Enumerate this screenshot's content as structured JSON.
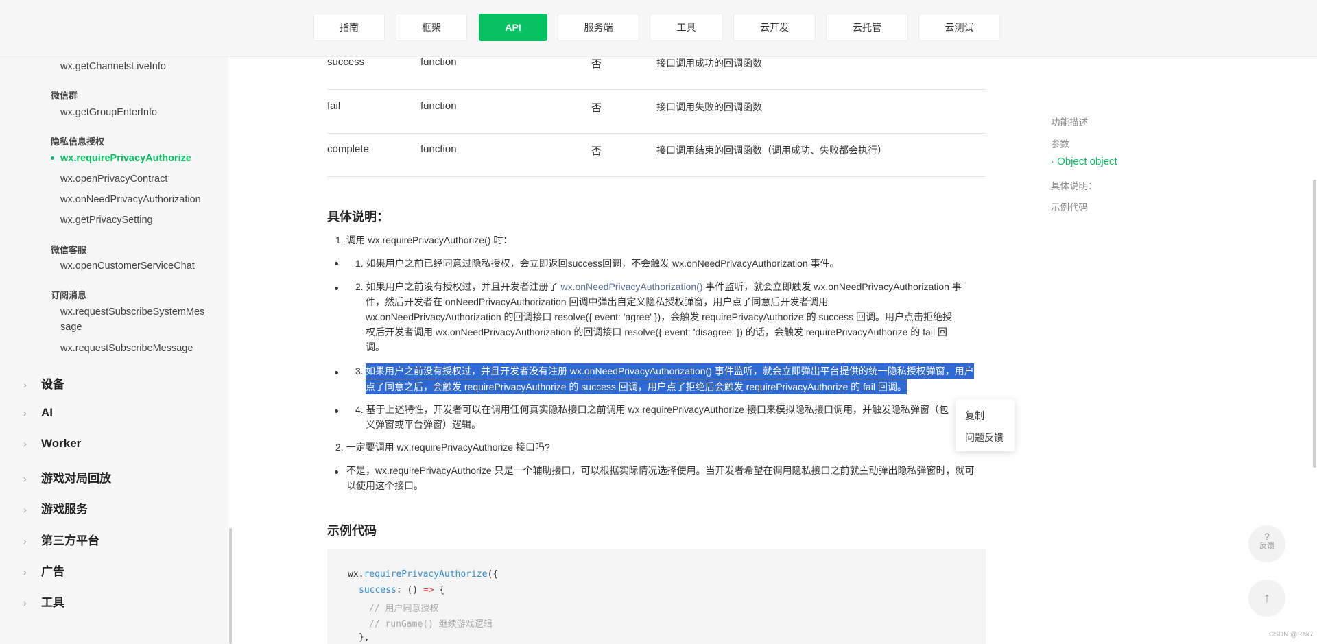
{
  "nav": {
    "tabs": [
      {
        "label": "指南",
        "active": false
      },
      {
        "label": "框架",
        "active": false
      },
      {
        "label": "API",
        "active": true
      },
      {
        "label": "服务端",
        "active": false
      },
      {
        "label": "工具",
        "active": false
      },
      {
        "label": "云开发",
        "active": false
      },
      {
        "label": "云托管",
        "active": false
      },
      {
        "label": "云测试",
        "active": false
      }
    ]
  },
  "sidebar": {
    "items": {
      "getChannelsLiveInfo": "wx.getChannelsLiveInfo",
      "group_wechat_group": "微信群",
      "getGroupEnterInfo": "wx.getGroupEnterInfo",
      "group_privacy": "隐私信息授权",
      "requirePrivacyAuthorize": "wx.requirePrivacyAuthorize",
      "openPrivacyContract": "wx.openPrivacyContract",
      "onNeedPrivacyAuthorization": "wx.onNeedPrivacyAuthorization",
      "getPrivacySetting": "wx.getPrivacySetting",
      "group_customer": "微信客服",
      "openCustomerServiceChat": "wx.openCustomerServiceChat",
      "group_subscribe": "订阅消息",
      "requestSubscribeSystemMessage_1": "wx.requestSubscribeSystemMes",
      "requestSubscribeSystemMessage_2": "sage",
      "requestSubscribeMessage": "wx.requestSubscribeMessage"
    },
    "sections": [
      "设备",
      "AI",
      "Worker",
      "游戏对局回放",
      "游戏服务",
      "第三方平台",
      "广告",
      "工具"
    ]
  },
  "params": [
    {
      "name": "success",
      "type": "function",
      "required": "否",
      "desc": "接口调用成功的回调函数"
    },
    {
      "name": "fail",
      "type": "function",
      "required": "否",
      "desc": "接口调用失败的回调函数"
    },
    {
      "name": "complete",
      "type": "function",
      "required": "否",
      "desc": "接口调用结束的回调函数（调用成功、失败都会执行）"
    }
  ],
  "details": {
    "heading": "具体说明：",
    "q1": "1. 调用 wx.requirePrivacyAuthorize() 时：",
    "b1": "1. 如果用户之前已经同意过隐私授权，会立即返回success回调，不会触发 wx.onNeedPrivacyAuthorization 事件。",
    "b2_pre": "2. 如果用户之前没有授权过，并且开发者注册了 ",
    "b2_link": "wx.onNeedPrivacyAuthorization()",
    "b2_post": " 事件监听，就会立即触发 wx.onNeedPrivacyAuthorization 事",
    "b2_l2": "件，然后开发者在 onNeedPrivacyAuthorization 回调中弹出自定义隐私授权弹窗，用户点了同意后开发者调用",
    "b2_l3": "wx.onNeedPrivacyAuthorization 的回调接口 resolve({ event: 'agree' })，会触发 requirePrivacyAuthorize 的 success 回调。用户点击拒绝授",
    "b2_l4": "权后开发者调用 wx.onNeedPrivacyAuthorization 的回调接口 resolve({ event: 'disagree' }) 的话，会触发 requirePrivacyAuthorize 的 fail 回",
    "b2_l5": "调。",
    "b3_num": "3.",
    "b3_l1": "如果用户之前没有授权过，并且开发者没有注册 wx.onNeedPrivacyAuthorization() 事件监听，就会立即弹出平台提供的统一隐私授权弹窗，用户",
    "b3_l2": "点了同意之后，会触发 requirePrivacyAuthorize 的 success 回调，用户点了拒绝后会触发 requirePrivacyAuthorize 的 fail 回调。",
    "b4_l1": "4. 基于上述特性，开发者可以在调用任何真实隐私接口之前调用 wx.requirePrivacyAuthorize 接口来模拟隐私接口调用，并触发隐私弹窗（包",
    "b4_l2": "义弹窗或平台弹窗）逻辑。",
    "q2": "2. 一定要调用 wx.requirePrivacyAuthorize 接口吗?",
    "a2_l1": "不是，wx.requirePrivacyAuthorize 只是一个辅助接口，可以根据实际情况选择使用。当开发者希望在调用隐私接口之前就主动弹出隐私弹窗时，就可",
    "a2_l2": "以使用这个接口。"
  },
  "example": {
    "heading": "示例代码",
    "obj": "wx.",
    "fn": "requirePrivacyAuthorize",
    "open": "({",
    "key": "success",
    "colon": ": () ",
    "arrow": "=>",
    "brace": " {",
    "c1": "// 用户同意授权",
    "c2": "// runGame() 继续游戏逻辑",
    "close": "},"
  },
  "context_menu": {
    "copy": "复制",
    "feedback": "问题反馈"
  },
  "toc": [
    {
      "label": "功能描述",
      "active": false
    },
    {
      "label": "参数",
      "active": false
    },
    {
      "label": "· Object object",
      "active": true
    },
    {
      "label": "具体说明：",
      "active": false
    },
    {
      "label": "示例代码",
      "active": false
    }
  ],
  "floating": {
    "help_glyph": "?",
    "feedback_label": "反馈",
    "up_glyph": "↑"
  },
  "credit": "CSDN @Rak7",
  "colors": {
    "brand": "#07c160",
    "selection": "#2f6ad4",
    "link": "#576b95"
  }
}
